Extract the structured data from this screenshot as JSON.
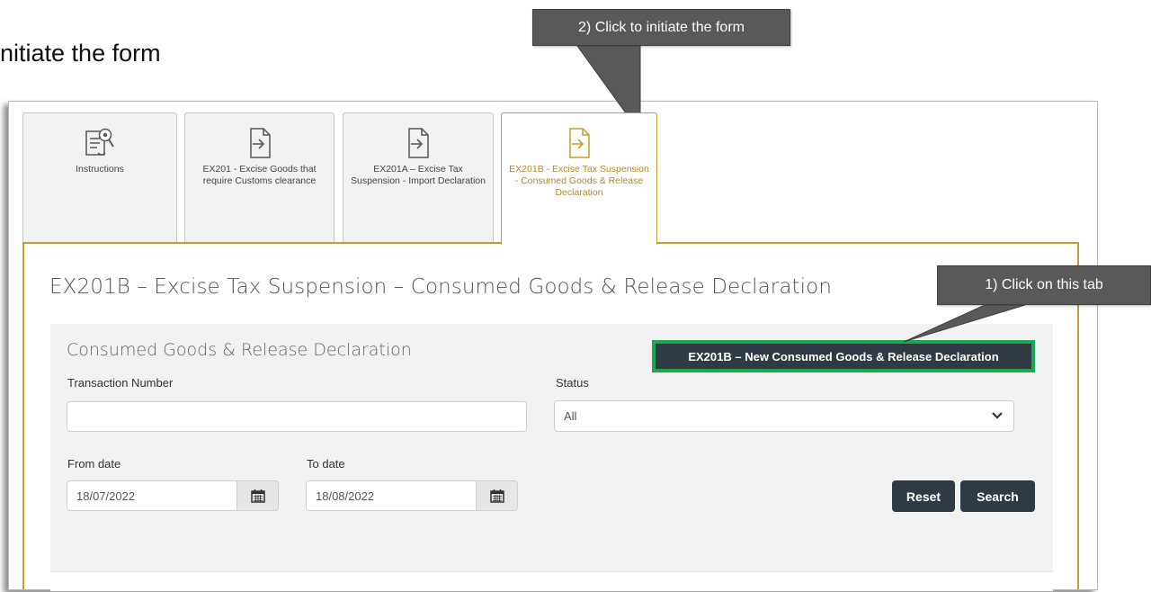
{
  "doc": {
    "heading_fragment": "nitiate the form"
  },
  "tabs": [
    {
      "label": "Instructions",
      "icon": "instructions-icon"
    },
    {
      "label": "EX201 - Excise Goods that require Customs clearance",
      "icon": "file-import-icon"
    },
    {
      "label": "EX201A – Excise Tax Suspension - Import Declaration",
      "icon": "file-import-icon"
    },
    {
      "label": "EX201B - Excise Tax Suspension - Consumed Goods & Release Declaration",
      "icon": "file-import-icon"
    }
  ],
  "page": {
    "title": "EX201B – Excise Tax Suspension – Consumed Goods & Release Declaration"
  },
  "search": {
    "title": "Consumed Goods & Release Declaration",
    "new_button_label": "EX201B – New Consumed Goods & Release Declaration",
    "transaction_label": "Transaction Number",
    "transaction_value": "",
    "status_label": "Status",
    "status_value": "All",
    "from_label": "From date",
    "from_value": "18/07/2022",
    "to_label": "To date",
    "to_value": "18/08/2022",
    "reset_label": "Reset",
    "search_label": "Search"
  },
  "callouts": {
    "initiate": "2) Click to initiate the form",
    "tab": "1) Click on this tab"
  },
  "colors": {
    "accent_gold": "#c59d2e",
    "dark_button": "#2f3a44",
    "highlight_green": "#19a84b",
    "callout_gray": "#595959"
  }
}
